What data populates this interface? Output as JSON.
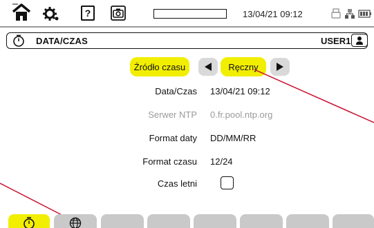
{
  "statusbar": {
    "datetime": "13/04/21 09:12",
    "recording_progress": 0.0,
    "icons": [
      "home-icon",
      "gear-icon",
      "help-icon",
      "camera-icon",
      "usb-icon",
      "network-icon",
      "battery-icon"
    ]
  },
  "titlebar": {
    "title": "DATA/CZAS",
    "user": "USER1",
    "icons": [
      "clock-icon",
      "user-icon"
    ]
  },
  "form": {
    "time_source_label": "Źródło czasu",
    "time_source_value": "Ręczny",
    "fields": [
      {
        "label": "Data/Czas",
        "value": "13/04/21 09:12",
        "enabled": true
      },
      {
        "label": "Serwer NTP",
        "value": "0.fr.pool.ntp.org",
        "enabled": false
      },
      {
        "label": "Format daty",
        "value": "DD/MM/RR",
        "enabled": true
      },
      {
        "label": "Format czasu",
        "value": "12/24",
        "enabled": true
      }
    ],
    "dst_label": "Czas letni",
    "dst_checked": false
  },
  "tabs": [
    {
      "icon": "clock-icon",
      "active": true
    },
    {
      "icon": "globe-icon",
      "active": false
    },
    {
      "icon": "",
      "active": false
    },
    {
      "icon": "",
      "active": false
    },
    {
      "icon": "",
      "active": false
    },
    {
      "icon": "",
      "active": false
    },
    {
      "icon": "",
      "active": false
    },
    {
      "icon": "",
      "active": false
    }
  ],
  "colors": {
    "highlight": "#f2ee00",
    "callout_line": "#c8102e",
    "tab_inactive": "#c9c9c9",
    "disabled_text": "#9a9a9a"
  }
}
